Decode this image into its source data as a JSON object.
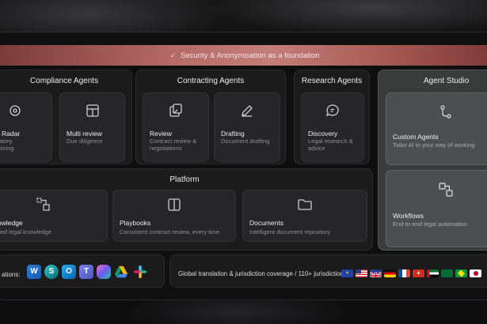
{
  "banner": {
    "text": "Security & Anonymisation as a foundation"
  },
  "compliance": {
    "title": "Compliance Agents",
    "cards": [
      {
        "title": "al Radar",
        "subtitle_1": "ulatory",
        "subtitle_2": "nitoring"
      },
      {
        "title": "Multi review",
        "subtitle_1": "Due diligence"
      }
    ]
  },
  "contracting": {
    "title": "Contracting Agents",
    "cards": [
      {
        "title": "Review",
        "subtitle_1": "Contract review &",
        "subtitle_2": "negotiations"
      },
      {
        "title": "Drafting",
        "subtitle_1": "Document drafting"
      }
    ]
  },
  "research": {
    "title": "Research Agents",
    "cards": [
      {
        "title": "Discovery",
        "subtitle_1": "Legal research &",
        "subtitle_2": "advice"
      }
    ]
  },
  "studio": {
    "title": "Agent Studio",
    "cards": [
      {
        "title": "Custom Agents",
        "subtitle_1": "Tailor AI to your way of working"
      },
      {
        "title": "Workflows",
        "subtitle_1": "End-to-end legal automation"
      }
    ]
  },
  "platform": {
    "title": "Platform",
    "cards": [
      {
        "title": "owledge",
        "subtitle_1": "fied legal knowledge"
      },
      {
        "title": "Playbooks",
        "subtitle_1": "Consistent contract review, every time"
      },
      {
        "title": "Documents",
        "subtitle_1": "Intelligent document repository"
      }
    ]
  },
  "integrations": {
    "label": "ations:"
  },
  "coverage": {
    "text": "Global translation & jurisdiction coverage / 110+ jurisdictions"
  }
}
